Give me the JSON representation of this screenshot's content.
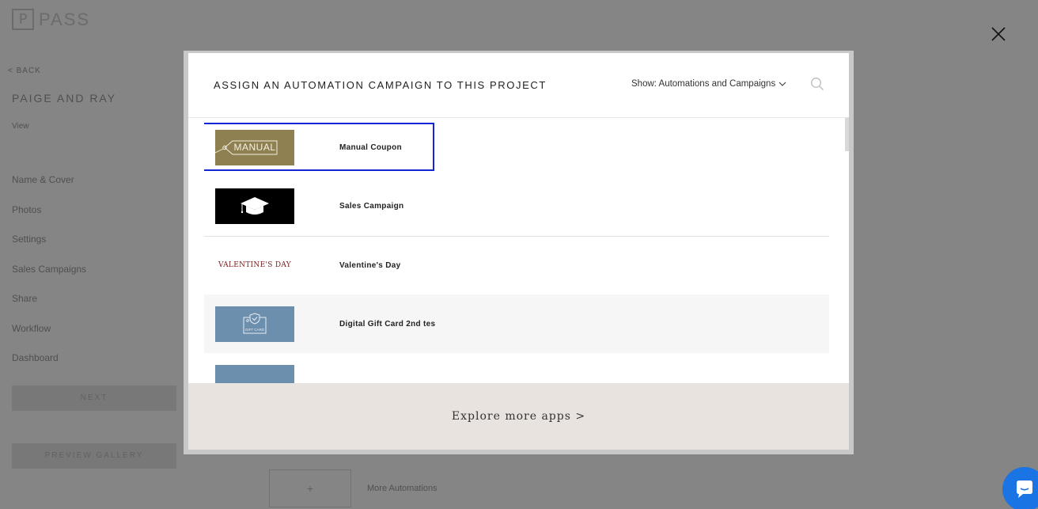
{
  "background": {
    "logo_letter": "P",
    "logo_text": "PASS",
    "back_label": "< BACK",
    "project_title": "PAIGE AND RAY",
    "view_label": "View",
    "nav_items": [
      "Name & Cover",
      "Photos",
      "Settings",
      "Sales Campaigns",
      "Share",
      "Workflow",
      "Dashboard"
    ],
    "next_label": "NEXT",
    "preview_label": "PREVIEW GALLERY",
    "more_automations_label": "More Automations",
    "more_automations_plus": "+"
  },
  "modal": {
    "title": "ASSIGN AN AUTOMATION CAMPAIGN TO THIS PROJECT",
    "filter_label": "Show: Automations and Campaigns",
    "search_icon": "search-icon",
    "items": [
      {
        "label": "Manual Coupon",
        "thumb_text": "MANUAL",
        "thumb_color": "#8f8052",
        "thumb_icon": "tag-icon",
        "selected": true
      },
      {
        "label": "Sales Campaign",
        "thumb_color": "#000000",
        "thumb_icon": "graduation-cap-icon"
      },
      {
        "label": "Valentine's Day",
        "thumb_text": "VALENTINE'S DAY",
        "thumb_text_color": "#7a1a1a",
        "thumb_color": "#ffffff"
      },
      {
        "label": "Digital Gift Card 2nd tes",
        "thumb_color": "#6d8fae",
        "thumb_icon": "gift-card-icon",
        "thumb_icon_text": "GIFT CARD"
      },
      {
        "label": "",
        "thumb_color": "#6d8fae"
      }
    ],
    "footer_link": "Explore more apps >"
  },
  "colors": {
    "selection_outline": "#1326d4",
    "footer_bg": "#e8e3de",
    "chat_bubble": "#1b74e4"
  },
  "icons": {
    "close": "close-icon",
    "chat": "chat-icon"
  }
}
